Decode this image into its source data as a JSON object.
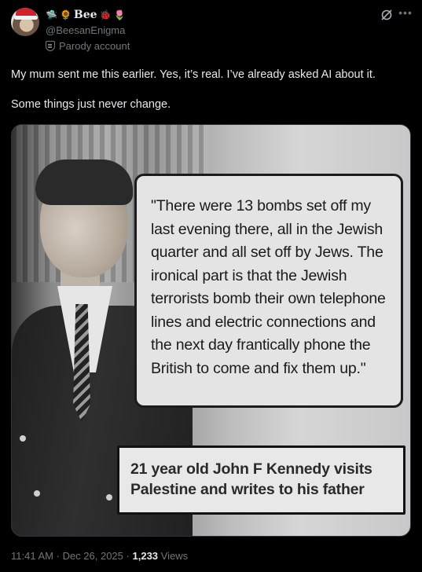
{
  "author": {
    "display_name": "Bee",
    "name_emojis_before": [
      "🛸",
      "🌻"
    ],
    "name_emojis_after": [
      "🐞",
      "🌷"
    ],
    "handle": "@BeesanEnigma",
    "badge_label": "Parody account",
    "badge_icon": "parody-mask-icon"
  },
  "post": {
    "paragraphs": [
      "My mum sent me this earlier. Yes, it’s real. I’ve already asked AI about it.",
      "Some things just never change."
    ]
  },
  "media": {
    "quote_text": "\"There were 13 bombs set off my last evening there, all in the Jewish quarter and all set off by Jews. The ironical part is that the Jewish terrorists bomb their own telephone lines and electric connections and the next day frantically phone the British to come and fix them up.\"",
    "caption_text": "21 year old John F Kennedy visits Palestine and writes to his father"
  },
  "meta": {
    "time": "11:41 AM",
    "separator": "·",
    "date": "Dec 26, 2025",
    "views_count": "1,233",
    "views_label": "Views"
  },
  "colors": {
    "background": "#000000",
    "primary_text": "#e7e9ea",
    "secondary_text": "#71767b",
    "border": "#2f3336"
  }
}
